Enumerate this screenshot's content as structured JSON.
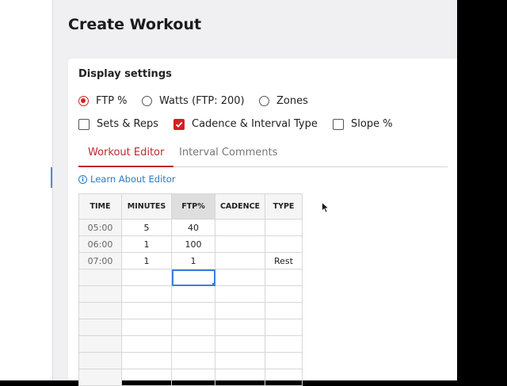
{
  "page_title": "Create Workout",
  "display_settings": {
    "title": "Display settings",
    "radios": [
      {
        "label": "FTP %",
        "checked": true
      },
      {
        "label": "Watts (FTP: 200)",
        "checked": false
      },
      {
        "label": "Zones",
        "checked": false
      }
    ],
    "checkboxes": [
      {
        "label": "Sets & Reps",
        "checked": false
      },
      {
        "label": "Cadence & Interval Type",
        "checked": true
      },
      {
        "label": "Slope %",
        "checked": false
      }
    ]
  },
  "tabs": [
    {
      "label": "Workout Editor",
      "active": true
    },
    {
      "label": "Interval Comments",
      "active": false
    }
  ],
  "learn_link": "Learn About Editor",
  "table": {
    "columns": [
      "TIME",
      "MINUTES",
      "FTP%",
      "CADENCE",
      "TYPE"
    ],
    "rows": [
      [
        "05:00",
        "5",
        "40",
        "",
        ""
      ],
      [
        "06:00",
        "1",
        "100",
        "",
        ""
      ],
      [
        "07:00",
        "1",
        "1",
        "",
        "Rest"
      ]
    ],
    "empty_rows": 7
  },
  "colors": {
    "accent_red": "#d42020",
    "link_blue": "#2b7bc4",
    "selection_blue": "#3a7de6"
  }
}
